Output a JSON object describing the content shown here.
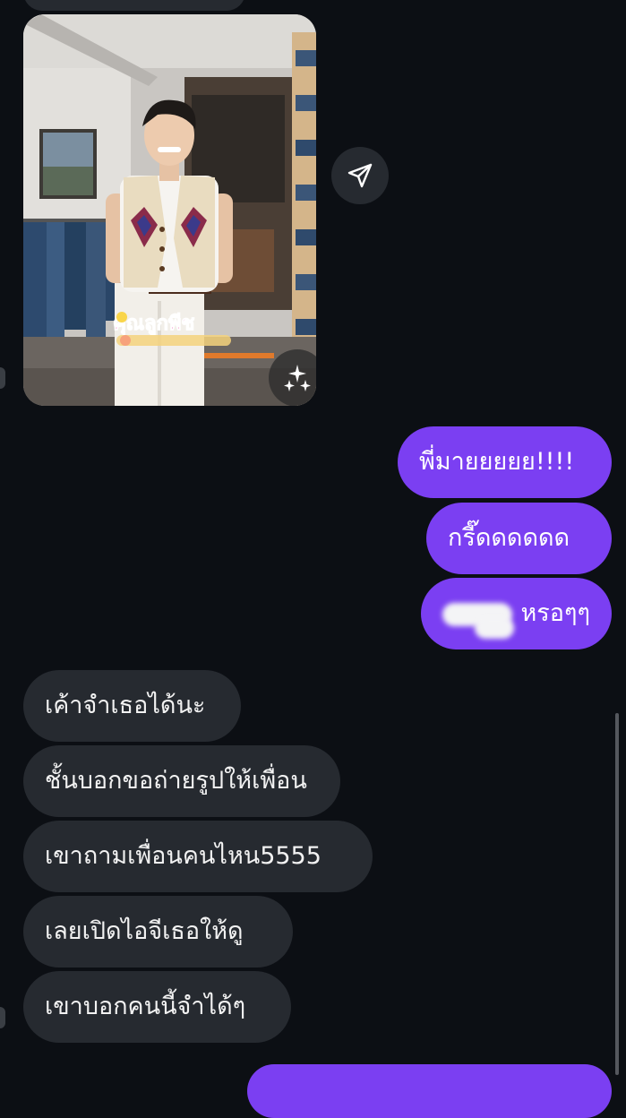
{
  "thread": {
    "photo": {
      "watermark": "คุณลูกพีช",
      "sparkle_icon": "sparkles-icon"
    },
    "share_icon": "paper-plane-icon",
    "sent_messages": [
      {
        "text": "พี่มายยยยย!!!!"
      },
      {
        "text": "กรี๊ดดดดดด"
      },
      {
        "text": "หรอๆๆ"
      }
    ],
    "received_messages": [
      {
        "text": "เค้าจำเธอได้นะ"
      },
      {
        "text": "ชั้นบอกขอถ่ายรูปให้เพื่อน"
      },
      {
        "text": "เขาถามเพื่อนคนไหน5555"
      },
      {
        "text": "เลยเปิดไอจีเธอให้ดู"
      },
      {
        "text": "เขาบอกคนนี้จำได้ๆ"
      }
    ]
  },
  "colors": {
    "background": "#0c0f14",
    "sent_bubble": "#7b3ff2",
    "received_bubble": "#262a30"
  }
}
